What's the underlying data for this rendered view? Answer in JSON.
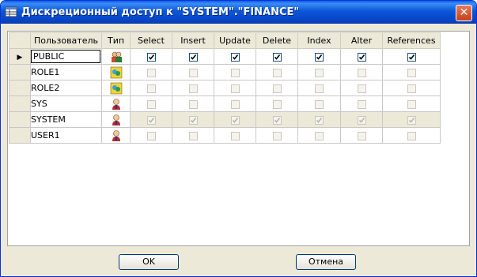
{
  "window": {
    "title": "Дискреционный доступ к \"SYSTEM\".\"FINANCE\""
  },
  "grid": {
    "columns": [
      "Пользователь",
      "Тип",
      "Select",
      "Insert",
      "Update",
      "Delete",
      "Index",
      "Alter",
      "References"
    ],
    "rows": [
      {
        "user": "PUBLIC",
        "type_icon": "group-icon",
        "perms": [
          true,
          true,
          true,
          true,
          true,
          true,
          true
        ],
        "current": true,
        "disabled": false
      },
      {
        "user": "ROLE1",
        "type_icon": "role-icon",
        "perms": [
          false,
          false,
          false,
          false,
          false,
          false,
          false
        ],
        "current": false,
        "disabled": true
      },
      {
        "user": "ROLE2",
        "type_icon": "role-icon",
        "perms": [
          false,
          false,
          false,
          false,
          false,
          false,
          false
        ],
        "current": false,
        "disabled": true
      },
      {
        "user": "SYS",
        "type_icon": "user-icon",
        "perms": [
          false,
          false,
          false,
          false,
          false,
          false,
          false
        ],
        "current": false,
        "disabled": true
      },
      {
        "user": "SYSTEM",
        "type_icon": "user-icon",
        "perms": [
          true,
          true,
          true,
          true,
          true,
          true,
          true
        ],
        "current": false,
        "disabled": true
      },
      {
        "user": "USER1",
        "type_icon": "user-icon",
        "perms": [
          false,
          false,
          false,
          false,
          false,
          false,
          false
        ],
        "current": false,
        "disabled": true
      }
    ]
  },
  "buttons": {
    "ok": "OK",
    "cancel": "Отмена"
  }
}
